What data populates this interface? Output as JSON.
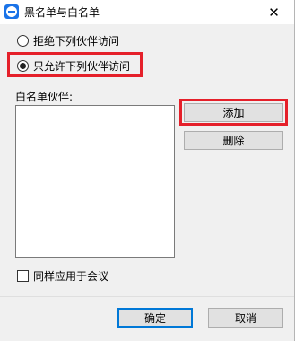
{
  "window": {
    "title": "黑名单与白名单",
    "close_glyph": "✕"
  },
  "mode": {
    "options": [
      {
        "label": "拒绝下列伙伴访问",
        "checked": false
      },
      {
        "label": "只允许下列伙伴访问",
        "checked": true
      }
    ]
  },
  "whitelist": {
    "label": "白名单伙伴:"
  },
  "actions": {
    "add_label": "添加",
    "delete_label": "删除"
  },
  "meeting": {
    "label": "同样应用于会议",
    "checked": false
  },
  "footer": {
    "ok_label": "确定",
    "cancel_label": "取消"
  },
  "highlight_color": "#e5202a",
  "icons": {
    "app": "teamviewer-icon",
    "close": "close-icon"
  }
}
